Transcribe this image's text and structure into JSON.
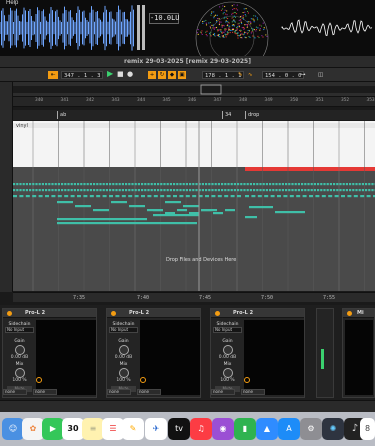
{
  "menu": {
    "help": "Help"
  },
  "meters": {
    "lufs": "-10.0LU"
  },
  "window": {
    "title": "remix 29-03-2025  [remix 29-03-2025]"
  },
  "transport": {
    "position": "347 .  1 .  3",
    "loop_start": "178 .  1 .  1",
    "loop_length": "154 .  0 .  0"
  },
  "ruler": {
    "bars": [
      "340",
      "341",
      "342",
      "343",
      "344",
      "345",
      "346",
      "347",
      "348",
      "349",
      "350",
      "351",
      "352",
      "353"
    ]
  },
  "locators": [
    {
      "label": "ab"
    },
    {
      "label": "34"
    },
    {
      "label": "drop"
    }
  ],
  "clip": {
    "name": "vinyl"
  },
  "arrangement": {
    "drop_hint": "Drop Files and Devices Here"
  },
  "timeline": {
    "labels": [
      "7:35",
      "7:40",
      "7:45",
      "7:50",
      "7:55"
    ]
  },
  "devices": [
    {
      "title": "Pro-L 2",
      "sidechain": "Sidechain",
      "input": "No Input",
      "gain_label": "Gain",
      "gain": "0.00 dB",
      "mix_label": "Mix",
      "mix": "100 %",
      "mode": "Mute",
      "out1": "none",
      "out2": "none"
    },
    {
      "title": "Pro-L 2",
      "sidechain": "Sidechain",
      "input": "No Input",
      "gain_label": "Gain",
      "gain": "0.00 dB",
      "mix_label": "Mix",
      "mix": "100 %",
      "mode": "Mute",
      "out1": "none",
      "out2": "none"
    },
    {
      "title": "Pro-L 2",
      "sidechain": "Sidechain",
      "input": "No Input",
      "gain_label": "Gain",
      "gain": "0.00 dB",
      "mix_label": "Mix",
      "mix": "100 %",
      "mode": "Mute",
      "out1": "none",
      "out2": "none"
    },
    {
      "title": "Mi"
    }
  ],
  "dock": {
    "calendar_day": "30",
    "apps": [
      "finder-icon",
      "photos-icon",
      "facetime-icon",
      "calendar-icon",
      "notes-icon",
      "reminders-icon",
      "freeform-icon",
      "tv-icon",
      "music-icon",
      "podcasts-icon",
      "numbers-icon",
      "keynote-icon",
      "appstore-icon",
      "settings-icon",
      "audio-icon",
      "waveform-icon",
      "ableton-icon",
      "app-icon"
    ]
  },
  "colors": {
    "accent": "#f39c12",
    "clip": "#3fbfa8",
    "red": "#e53935",
    "grid": "#4a4a4a"
  }
}
